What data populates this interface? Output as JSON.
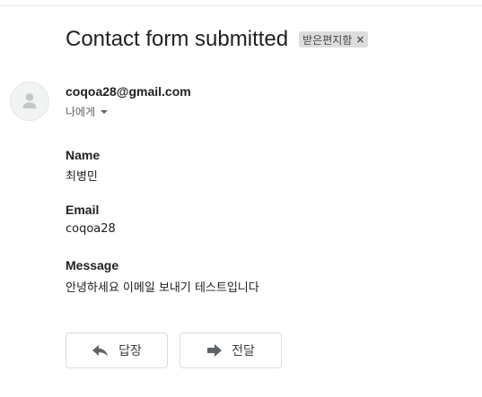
{
  "email": {
    "subject": "Contact form submitted",
    "label": "받은편지함",
    "label_close": "×",
    "sender": "coqoa28@gmail.com",
    "recipient": "나에게"
  },
  "fields": [
    {
      "label": "Name",
      "value": "최병민"
    },
    {
      "label": "Email",
      "value": "coqoa28"
    },
    {
      "label": "Message",
      "value": "안녕하세요 이메일 보내기 테스트입니다"
    }
  ],
  "actions": {
    "reply_label": "답장",
    "forward_label": "전달"
  },
  "icons": {
    "avatar": "person-icon",
    "recipient_toggle": "caret-down-icon",
    "reply": "reply-icon",
    "forward": "forward-icon"
  },
  "colors": {
    "label_chip_bg": "#dddddd",
    "border": "#dadce0",
    "icon": "#5f6368"
  }
}
